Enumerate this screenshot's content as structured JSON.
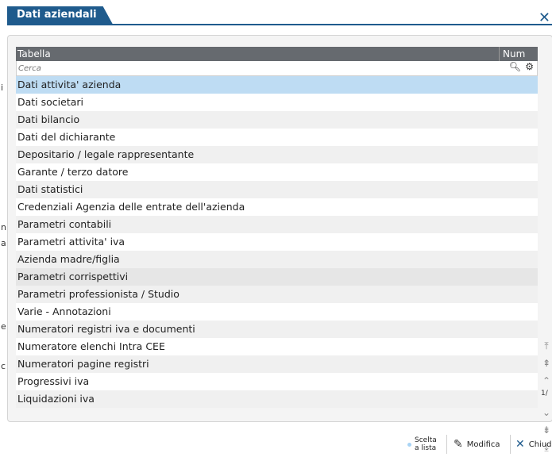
{
  "dialog": {
    "title": "Dati aziendali",
    "close_glyph": "✕"
  },
  "table": {
    "header": {
      "tabella": "Tabella",
      "num": "Num"
    },
    "search": {
      "placeholder": "Cerca"
    },
    "rows": [
      "Dati attivita' azienda",
      "Dati societari",
      "Dati bilancio",
      "Dati del dichiarante",
      "Depositario / legale rappresentante",
      "Garante / terzo datore",
      "Dati statistici",
      "Credenziali Agenzia delle entrate dell'azienda",
      "Parametri contabili",
      "Parametri attivita' iva",
      "Azienda madre/figlia",
      "Parametri corrispettivi",
      "Parametri professionista / Studio",
      "Varie - Annotazioni",
      "Numeratori registri iva e documenti",
      "Numeratore elenchi Intra CEE",
      "Numeratori pagine registri",
      "Progressivi iva",
      "Liquidazioni iva"
    ],
    "selected_index": 0,
    "page_indicator": "1/"
  },
  "footer": {
    "scelta_line1": "Scelta",
    "scelta_line2": "a lista",
    "modifica": "Modifica",
    "chiudi": "Chiud"
  },
  "background_chars": [
    "i",
    "n",
    "a",
    "e",
    "c"
  ],
  "colors": {
    "accent": "#1f5b8d",
    "selected_row": "#bedcf3",
    "header": "#666a6f"
  },
  "icons": [
    "close-icon",
    "search-icon",
    "gear-icon",
    "scroll-first-icon",
    "page-up-icon",
    "line-up-icon",
    "line-down-icon",
    "page-down-icon",
    "scroll-last-icon",
    "pencil-icon"
  ]
}
